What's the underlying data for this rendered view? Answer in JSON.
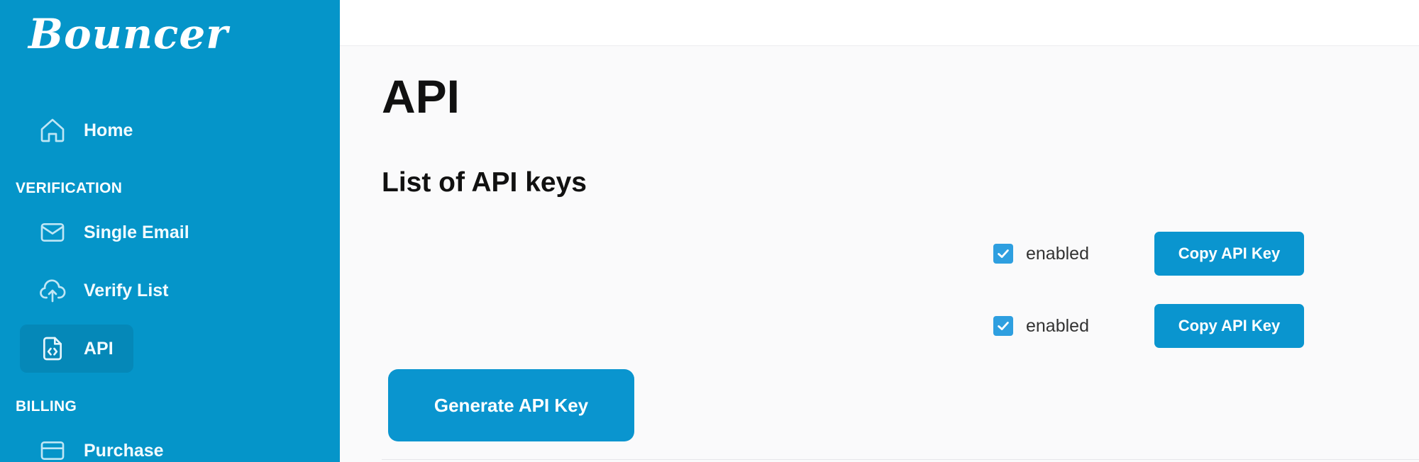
{
  "app": {
    "brand": "Bouncer"
  },
  "sidebar": {
    "home": {
      "label": "Home",
      "icon": "home-icon"
    },
    "verification_section": "VERIFICATION",
    "single_email": {
      "label": "Single Email",
      "icon": "mail-icon"
    },
    "verify_list": {
      "label": "Verify List",
      "icon": "cloud-upload-icon"
    },
    "api": {
      "label": "API",
      "icon": "api-file-icon",
      "active": true
    },
    "billing_section": "BILLING",
    "purchase": {
      "label": "Purchase",
      "icon": "credit-card-icon"
    }
  },
  "main": {
    "title": "API",
    "subtitle": "List of API keys",
    "keys": [
      {
        "enabled_label": "enabled",
        "enabled": true,
        "copy_label": "Copy API Key"
      },
      {
        "enabled_label": "enabled",
        "enabled": true,
        "copy_label": "Copy API Key"
      }
    ],
    "generate_label": "Generate API Key"
  },
  "colors": {
    "sidebar_bg": "#0595c9",
    "button_bg": "#0a95cf",
    "checkbox_bg": "#2e9fe0",
    "page_bg": "#fafafb"
  }
}
